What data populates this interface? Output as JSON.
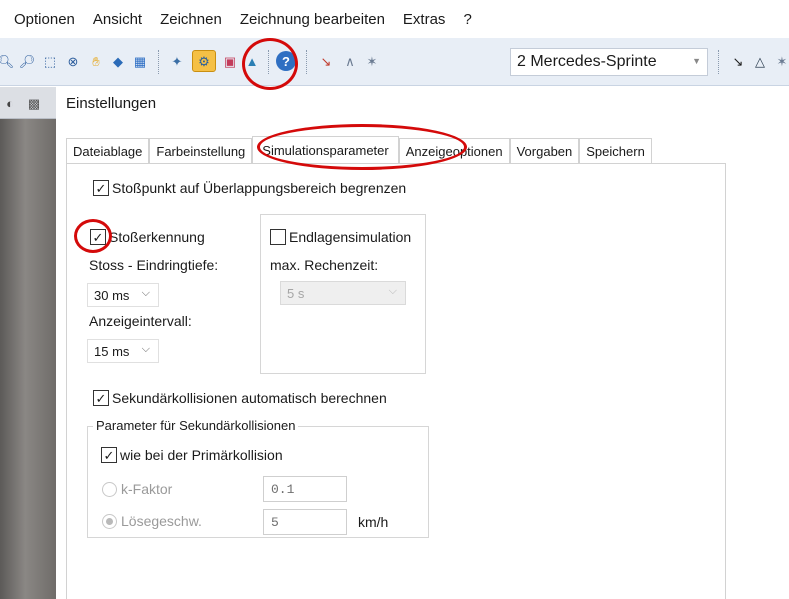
{
  "menubar": {
    "items": [
      {
        "label": "Optionen"
      },
      {
        "label": "Ansicht"
      },
      {
        "label": "Zeichnen"
      },
      {
        "label": "Zeichnung bearbeiten"
      },
      {
        "label": "Extras"
      },
      {
        "label": "?"
      }
    ]
  },
  "toolbar": {
    "vehicle_select": "2 Mercedes-Sprinte",
    "icons": [
      "zoom-in-icon",
      "zoom-out-icon",
      "zoom-region-icon",
      "zoom-fit-icon",
      "hand-icon",
      "vehicle-icon",
      "grid-icon",
      "collision-icon",
      "simulation-parameters-icon",
      "camera-icon",
      "car-icon",
      "help-icon",
      "trajectory-icon",
      "path-icon",
      "direction-icon",
      "cursor-icon",
      "polygon-icon",
      "area-icon"
    ]
  },
  "dialog": {
    "title": "Einstellungen",
    "tabs": [
      {
        "label": "Dateiablage"
      },
      {
        "label": "Farbeinstellung"
      },
      {
        "label": "Simulationsparameter"
      },
      {
        "label": "Anzeigeoptionen"
      },
      {
        "label": "Vorgaben"
      },
      {
        "label": "Speichern"
      }
    ],
    "active_tab": "Simulationsparameter"
  },
  "sim": {
    "limit_impact_point": {
      "label": "Stoßpunkt auf Überlappungsbereich begrenzen",
      "checked": true
    },
    "impact_detection": {
      "label": "Stoßerkennung",
      "checked": true
    },
    "penetration_depth_label": "Stoss - Eindringtiefe:",
    "penetration_depth_value": "30 ms",
    "display_interval_label": "Anzeigeintervall:",
    "display_interval_value": "15 ms",
    "end_position_sim": {
      "label": "Endlagensimulation",
      "checked": false
    },
    "max_compute_time_label": "max. Rechenzeit:",
    "max_compute_time_value": "5 s",
    "secondary_auto": {
      "label": "Sekundärkollisionen automatisch berechnen",
      "checked": true
    },
    "secondary_group_label": "Parameter für Sekundärkollisionen",
    "same_as_primary": {
      "label": "wie bei der Primärkollision",
      "checked": true
    },
    "k_factor": {
      "label": "k-Faktor",
      "value": "0.1",
      "selected": false
    },
    "separation_speed": {
      "label": "Lösegeschw.",
      "value": "5",
      "unit": "km/h",
      "selected": true
    }
  },
  "colors": {
    "highlight_circle": "#d40a0a",
    "toolbar_bg": "#e8eef6"
  }
}
